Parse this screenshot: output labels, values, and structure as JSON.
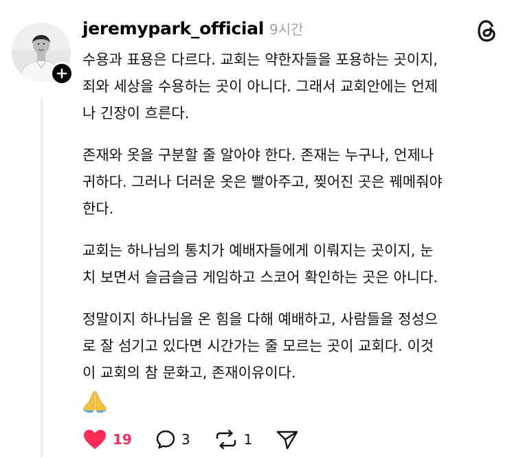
{
  "post": {
    "username": "jeremypark_official",
    "time": "9시간",
    "paragraphs": [
      [
        "수용과 표용은 다르다. 교회는 약한자들을 포용하는 곳이지,",
        "죄와 세상을 수용하는 곳이 아니다. 그래서 교회안에는 언제",
        "나 긴장이 흐른다."
      ],
      [
        "존재와 옷을 구분할 줄 알아야 한다. 존재는 누구나, 언제나",
        "귀하다. 그러나 더러운 옷은 빨아주고, 찢어진 곳은 꿰메줘야",
        "한다."
      ],
      [
        "교회는 하나님의 통치가 예배자들에게 이뤄지는 곳이지, 눈",
        "치 보면서 슬금슬금 게임하고 스코어 확인하는 곳은 아니다."
      ],
      [
        "정말이지 하나님을 온 힘을 다해 예배하고, 사람들을 정성으",
        "로 잘 섬기고 있다면 시간가는 줄 모르는 곳이 교회다. 이것",
        "이 교회의 참 문화고, 존재이유이다."
      ]
    ],
    "emoji": "folded-hands"
  },
  "actions": {
    "likes": "19",
    "replies": "3",
    "reposts": "1"
  },
  "colors": {
    "like": "#ff2d55",
    "muted": "#a3a3a3",
    "text": "#111111"
  }
}
